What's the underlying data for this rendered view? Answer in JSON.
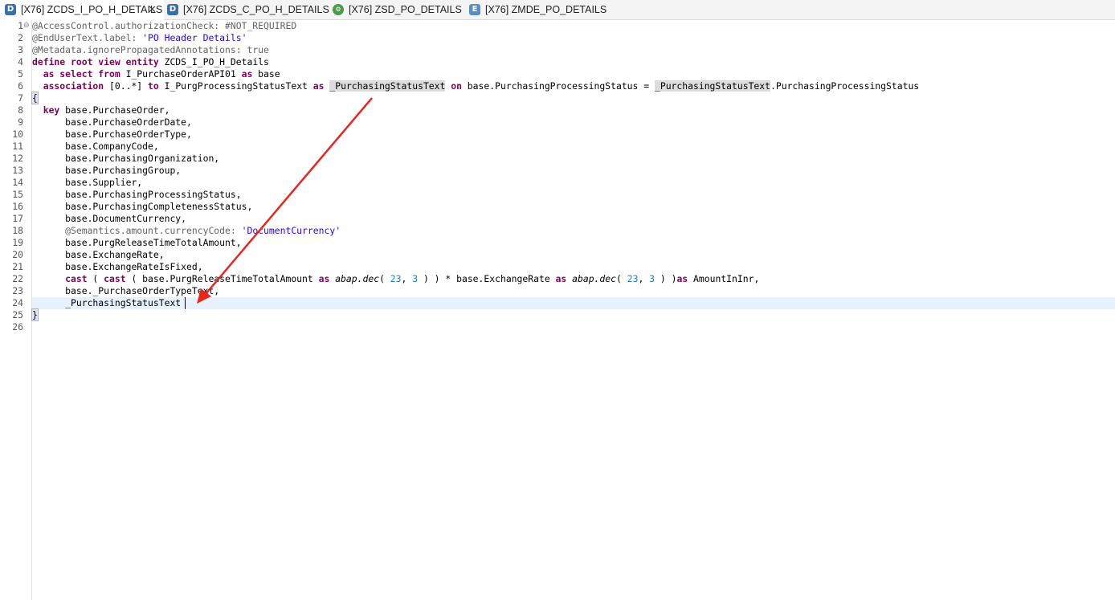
{
  "tabs": [
    {
      "label": "[X76] ZCDS_I_PO_H_DETAILS",
      "icon": "ddl-source-icon",
      "icon_letter": "D",
      "active": true,
      "close": "✕"
    },
    {
      "label": "[X76] ZCDS_C_PO_H_DETAILS",
      "icon": "ddl-source-icon",
      "icon_letter": "D",
      "active": false
    },
    {
      "label": "[X76] ZSD_PO_DETAILS",
      "icon": "service-definition-icon",
      "icon_letter": "⚙",
      "active": false
    },
    {
      "label": "[X76] ZMDE_PO_DETAILS",
      "icon": "metadata-extension-icon",
      "icon_letter": "E",
      "active": false
    }
  ],
  "editor": {
    "line_numbers": [
      "1",
      "2",
      "3",
      "4",
      "5",
      "6",
      "7",
      "8",
      "9",
      "10",
      "11",
      "12",
      "13",
      "14",
      "15",
      "16",
      "17",
      "18",
      "19",
      "20",
      "21",
      "22",
      "23",
      "24",
      "25",
      "26"
    ],
    "fold_marker": "⊖",
    "lines": {
      "l1": "@AccessControl.authorizationCheck: #NOT_REQUIRED",
      "l2a": "@EndUserText.label: ",
      "l2b": "'PO Header Details'",
      "l3": "@Metadata.ignorePropagatedAnnotations: true",
      "l4a": "define root view entity",
      "l4b": " ZCDS_I_PO_H_Details",
      "l5a": "  as select from",
      "l5b": " I_PurchaseOrderAPI01 ",
      "l5c": "as",
      "l5d": " base",
      "l6a": "  association",
      "l6b": " [0..*] ",
      "l6c": "to",
      "l6d": " I_PurgProcessingStatusText ",
      "l6e": "as",
      "l6f": " ",
      "l6g": "_PurchasingStatusText",
      "l6h": " ",
      "l6i": "on",
      "l6j": " base.PurchasingProcessingStatus = ",
      "l6k": "_PurchasingStatusText",
      "l6l": ".PurchasingProcessingStatus",
      "l7": "{",
      "l8a": "  key",
      "l8b": " base.PurchaseOrder,",
      "l9": "      base.PurchaseOrderDate,",
      "l10": "      base.PurchaseOrderType,",
      "l11": "      base.CompanyCode,",
      "l12": "      base.PurchasingOrganization,",
      "l13": "      base.PurchasingGroup,",
      "l14": "      base.Supplier,",
      "l15": "      base.PurchasingProcessingStatus,",
      "l16": "      base.PurchasingCompletenessStatus,",
      "l17": "      base.DocumentCurrency,",
      "l18a": "      @Semantics.amount.currencyCode: ",
      "l18b": "'DocumentCurrency'",
      "l19": "      base.PurgReleaseTimeTotalAmount,",
      "l20": "      base.ExchangeRate,",
      "l21": "      base.ExchangeRateIsFixed,",
      "l22a": "      cast",
      "l22b": " ( ",
      "l22c": "cast",
      "l22d": " ( base.PurgReleaseTimeTotalAmount ",
      "l22e": "as",
      "l22f": " ",
      "l22g": "abap.dec",
      "l22h": "( ",
      "l22i": "23",
      "l22j": ", ",
      "l22k": "3",
      "l22l": " ) ) * base.ExchangeRate ",
      "l22m": "as",
      "l22n": " ",
      "l22o": "abap.dec",
      "l22p": "( ",
      "l22q": "23",
      "l22r": ", ",
      "l22s": "3",
      "l22t": " ) )",
      "l22u": "as",
      "l22v": " AmountInInr,",
      "l23": "      base._PurchaseOrderTypeText,",
      "l24": "      _PurchasingStatusText",
      "l25": "}"
    }
  },
  "annotation_arrow": {
    "color": "#e8261f"
  }
}
